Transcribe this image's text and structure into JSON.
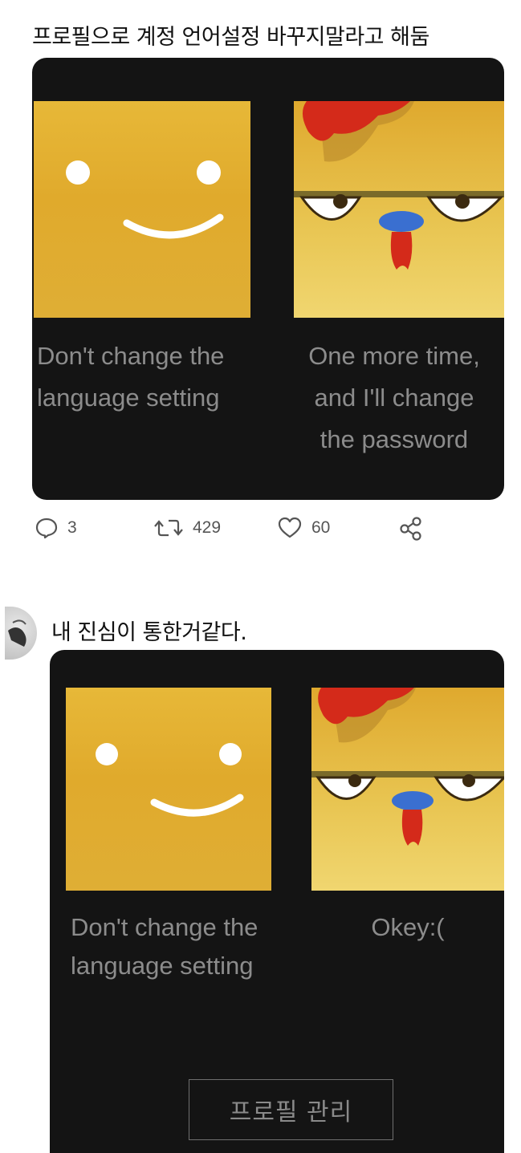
{
  "post1": {
    "text": "프로필으로 계정 언어설정 바꾸지말라고 해둠",
    "card": {
      "left_caption": [
        "Don't change the",
        "language setting"
      ],
      "right_caption": [
        "One more time,",
        "and I'll change",
        "the password"
      ]
    },
    "actions": {
      "replies": "3",
      "retweets": "429",
      "likes": "60"
    }
  },
  "post2": {
    "text": "내 진심이 통한거같다.",
    "card": {
      "left_caption": [
        "Don't change the",
        "language setting"
      ],
      "right_caption": [
        "Okey:("
      ],
      "manage_button": "프로필 관리"
    }
  },
  "colors": {
    "card_bg": "#141414",
    "caption": "#8c8c8c",
    "tile_yellow": "#e2af33",
    "comb_red": "#d42a1a",
    "beak_blue": "#3a6fd0"
  },
  "icons": [
    "reply-icon",
    "retweet-icon",
    "like-icon",
    "share-icon",
    "smile-face-icon",
    "chicken-face-icon"
  ]
}
